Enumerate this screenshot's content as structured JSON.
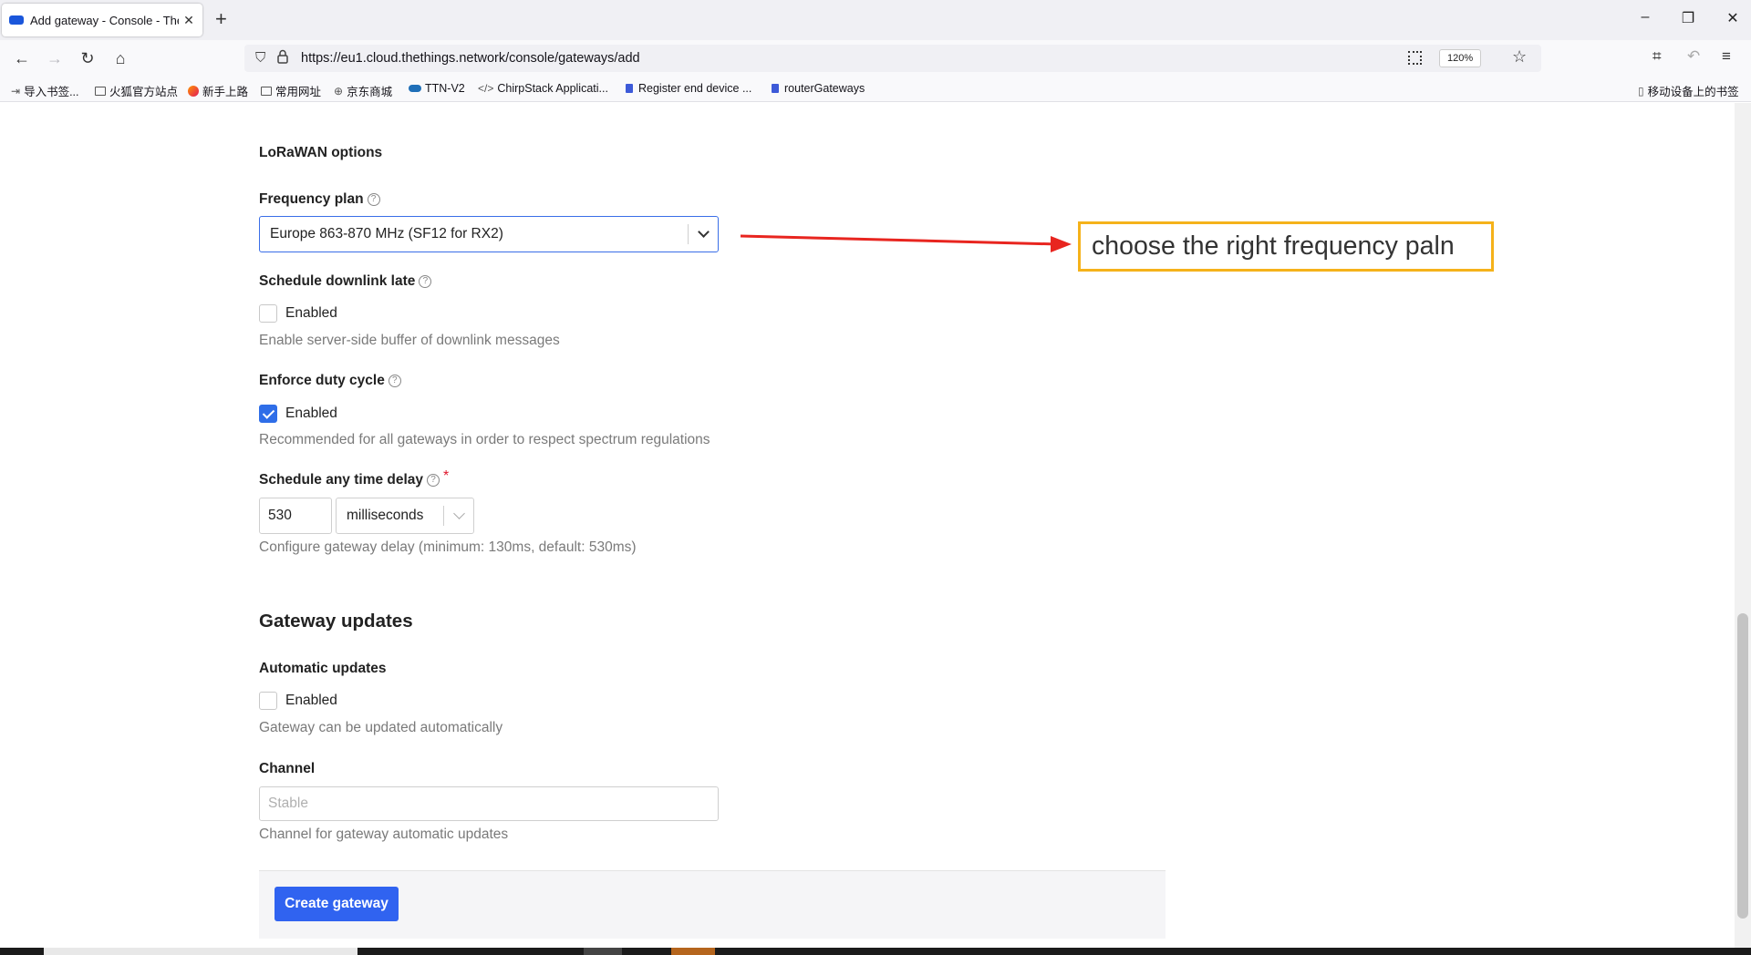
{
  "browser": {
    "tab_title": "Add gateway - Console - The",
    "url": "https://eu1.cloud.thethings.network/console/gateways/add",
    "zoom": "120%",
    "bookmarks": [
      "导入书签...",
      "火狐官方站点",
      "新手上路",
      "常用网址",
      "京东商城",
      "TTN-V2",
      "ChirpStack Applicati...",
      "Register end device ...",
      "routerGateways"
    ],
    "mobile_bookmarks": "移动设备上的书签"
  },
  "form": {
    "lorawan_title": "LoRaWAN options",
    "frequency_plan": {
      "label": "Frequency plan",
      "value": "Europe 863-870 MHz (SF12 for RX2)"
    },
    "schedule_downlink_late": {
      "label": "Schedule downlink late",
      "checkbox_label": "Enabled",
      "description": "Enable server-side buffer of downlink messages"
    },
    "enforce_duty_cycle": {
      "label": "Enforce duty cycle",
      "checkbox_label": "Enabled",
      "description": "Recommended for all gateways in order to respect spectrum regulations"
    },
    "schedule_any_time_delay": {
      "label": "Schedule any time delay",
      "required_mark": "*",
      "value": "530",
      "unit": "milliseconds",
      "description": "Configure gateway delay (minimum: 130ms, default: 530ms)"
    },
    "gateway_updates_title": "Gateway updates",
    "automatic_updates": {
      "label": "Automatic updates",
      "checkbox_label": "Enabled",
      "description": "Gateway can be updated automatically"
    },
    "channel": {
      "label": "Channel",
      "placeholder": "Stable",
      "description": "Channel for gateway automatic updates"
    },
    "submit_label": "Create gateway"
  },
  "annotation": {
    "text": "choose the right frequency paln",
    "arrow_color": "#e8251f",
    "box_color": "#f5b21a"
  },
  "colors": {
    "accent": "#3063f0",
    "checkbox_checked": "#2f6ee8",
    "required": "#e0162b"
  }
}
